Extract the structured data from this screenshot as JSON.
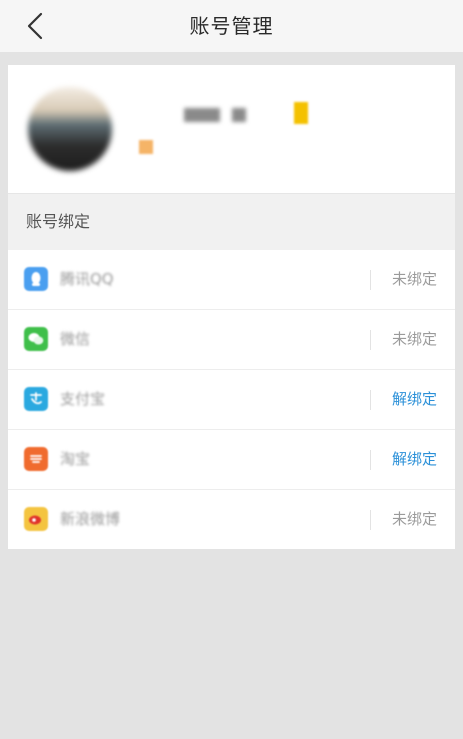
{
  "header": {
    "title": "账号管理",
    "back_icon": "chevron-left-icon"
  },
  "profile": {
    "avatar": "avatar",
    "badge_color": "#f5b467",
    "vip_color": "#f4c100"
  },
  "bindings": {
    "section_title": "账号绑定",
    "items": [
      {
        "label": "腾讯QQ",
        "icon": "qq-icon",
        "icon_color": "#4a9ff0",
        "action": "未绑定",
        "bound": false
      },
      {
        "label": "微信",
        "icon": "wechat-icon",
        "icon_color": "#3fbf4a",
        "action": "未绑定",
        "bound": false
      },
      {
        "label": "支付宝",
        "icon": "alipay-icon",
        "icon_color": "#2ba9e0",
        "action": "解绑定",
        "bound": true
      },
      {
        "label": "淘宝",
        "icon": "taobao-icon",
        "icon_color": "#f06b2e",
        "action": "解绑定",
        "bound": true
      },
      {
        "label": "新浪微博",
        "icon": "weibo-icon",
        "icon_color": "#f4c440",
        "action": "未绑定",
        "bound": false
      }
    ]
  },
  "colors": {
    "accent": "#2b90d8",
    "muted": "#9b9b9b",
    "background": "#e3e3e3"
  }
}
